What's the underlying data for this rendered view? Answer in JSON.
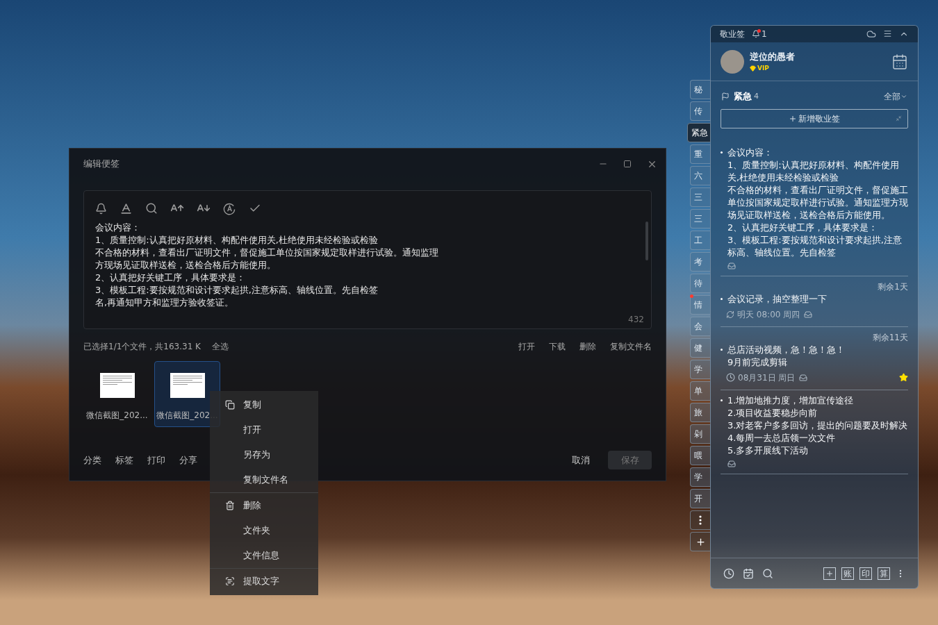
{
  "editor_window": {
    "title": "编辑便签",
    "text_lines": [
      "会议内容：",
      "1、质量控制:认真把好原材料、构配件使用关,杜绝使用未经检验或检验",
      "不合格的材料，查看出厂证明文件，督促施工单位按国家规定取样进行试验。通知监理",
      "方现场见证取样送检，送检合格后方能使用。",
      "2、认真把好关键工序，具体要求是：",
      "3、模板工程:要按规范和设计要求起拱,注意标高、轴线位置。先自检签",
      "名,再通知甲方和监理方验收签证。"
    ],
    "char_count": "432",
    "selection_info": "已选择1/1个文件，共163.31 K",
    "select_all": "全选",
    "file_actions": [
      "打开",
      "下载",
      "删除",
      "复制文件名"
    ],
    "files": [
      {
        "name": "微信截图_202...",
        "selected": false
      },
      {
        "name": "微信截图_202...",
        "selected": true
      }
    ],
    "bottom_actions": [
      {
        "label": "分类",
        "disabled": false
      },
      {
        "label": "标签",
        "disabled": false
      },
      {
        "label": "打印",
        "disabled": false
      },
      {
        "label": "分享",
        "disabled": false
      }
    ],
    "cancel": "取消",
    "save": {
      "label": "保存",
      "disabled": true
    }
  },
  "context_menu": {
    "items": [
      {
        "label": "复制",
        "kind": "copy",
        "divider_before": false
      },
      {
        "label": "打开",
        "kind": "plain",
        "divider_before": false
      },
      {
        "label": "另存为",
        "kind": "plain",
        "divider_before": false
      },
      {
        "label": "复制文件名",
        "kind": "plain",
        "divider_before": false
      },
      {
        "label": "删除",
        "kind": "trash",
        "divider_before": true
      },
      {
        "label": "文件夹",
        "kind": "plain",
        "divider_before": false
      },
      {
        "label": "文件信息",
        "kind": "plain",
        "divider_before": false
      },
      {
        "label": "提取文字",
        "kind": "ocr",
        "divider_before": true
      }
    ]
  },
  "side_tabs": [
    {
      "label": "秘",
      "selected": false,
      "dot": false
    },
    {
      "label": "传",
      "selected": false,
      "dot": false
    },
    {
      "label": "紧急",
      "selected": true,
      "dot": false
    },
    {
      "label": "重",
      "selected": false,
      "dot": false
    },
    {
      "label": "六",
      "selected": false,
      "dot": false
    },
    {
      "label": "三",
      "selected": false,
      "dot": false
    },
    {
      "label": "三",
      "selected": false,
      "dot": false
    },
    {
      "label": "工",
      "selected": false,
      "dot": false
    },
    {
      "label": "考",
      "selected": false,
      "dot": false
    },
    {
      "label": "待",
      "selected": false,
      "dot": false
    },
    {
      "label": "情",
      "selected": false,
      "dot": true
    },
    {
      "label": "会",
      "selected": false,
      "dot": false
    },
    {
      "label": "健",
      "selected": false,
      "dot": false
    },
    {
      "label": "学",
      "selected": false,
      "dot": false
    },
    {
      "label": "单",
      "selected": false,
      "dot": false
    },
    {
      "label": "旅",
      "selected": false,
      "dot": false
    },
    {
      "label": "剁",
      "selected": false,
      "dot": false
    },
    {
      "label": "喂",
      "selected": false,
      "dot": false
    },
    {
      "label": "学",
      "selected": false,
      "dot": false
    },
    {
      "label": "开",
      "selected": false,
      "dot": false
    }
  ],
  "notes_panel": {
    "app_name": "敬业签",
    "notification_count": "1",
    "user": {
      "name": "逆位的愚者",
      "badge": "VIP"
    },
    "category": {
      "name": "紧急",
      "count": "4",
      "filter": "全部"
    },
    "add_button": "新增敬业签",
    "notes": [
      {
        "paragraphs": [
          "会议内容：",
          "1、质量控制:认真把好原材料、构配件使用关,杜绝使用未经检验或检验",
          "不合格的材料，查看出厂证明文件，督促施工单位按国家规定取样进行试验。通知监理方现场见证取样送检，送检合格后方能使用。",
          "2、认真把好关键工序，具体要求是：",
          "3、模板工程:要按规范和设计要求起拱,注意标高、轴线位置。先自检签"
        ],
        "starred": false
      },
      {
        "due": "剩余1天",
        "paragraphs": [
          "会议记录，抽空整理一下"
        ],
        "meta": {
          "kind": "repeat",
          "text": "明天 08:00 周四"
        },
        "starred": false
      },
      {
        "due": "剩余11天",
        "paragraphs": [
          "总店活动视频，急！急！急！",
          "9月前完成剪辑"
        ],
        "meta": {
          "kind": "clock",
          "text": "08月31日 周日"
        },
        "starred": true
      },
      {
        "paragraphs": [
          "1.增加地推力度，增加宣传途径",
          "2.项目收益要稳步向前",
          "3.对老客户多多回访，提出的问题要及时解决",
          "4.每周一去总店领一次文件",
          "5.多多开展线下活动"
        ],
        "starred": false
      }
    ],
    "tools": [
      "账",
      "印",
      "算"
    ]
  }
}
